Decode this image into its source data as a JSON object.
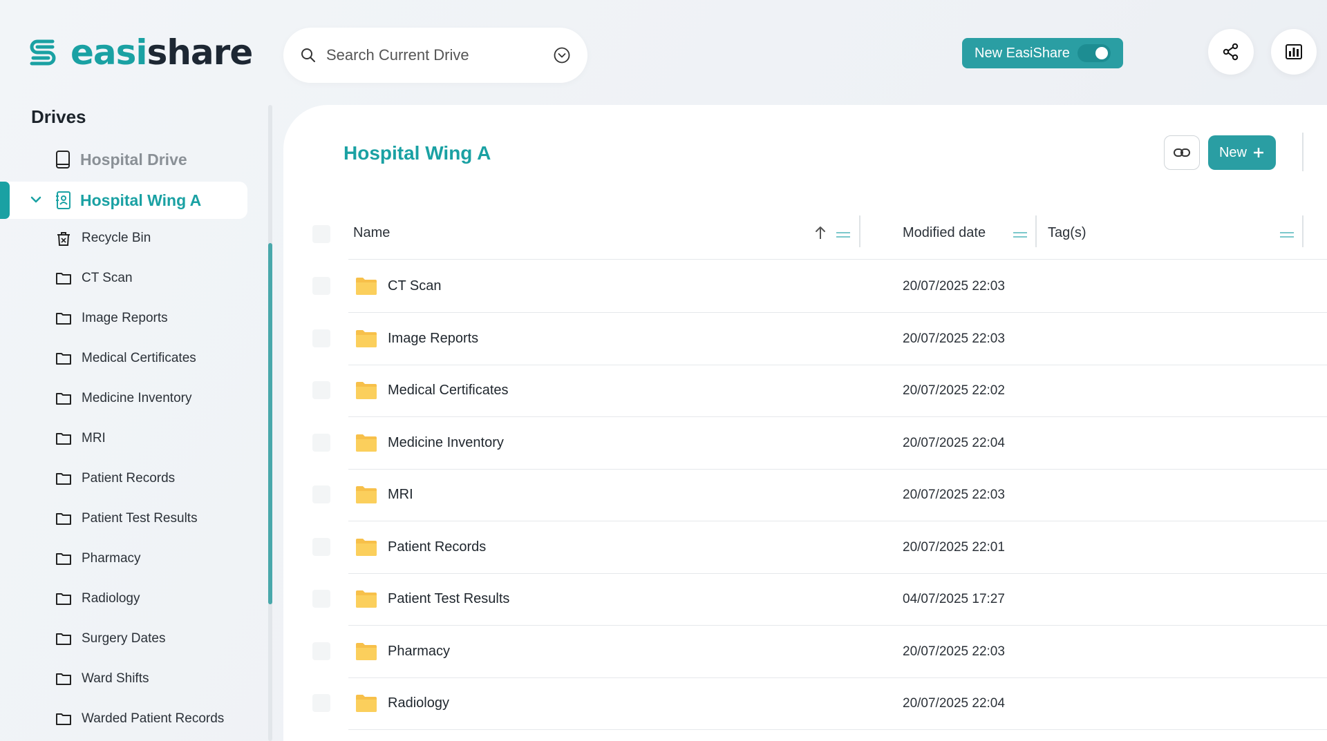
{
  "brand": {
    "prefix": "easi",
    "suffix": "share"
  },
  "search": {
    "placeholder": "Search Current Drive"
  },
  "header": {
    "toggle_label": "New EasiShare",
    "toggle_on": true,
    "share_icon": "share-nodes-icon",
    "stats_icon": "bar-chart-icon"
  },
  "sidebar": {
    "title": "Drives",
    "drives": [
      {
        "label": "Hospital Drive",
        "icon": "tablet-icon"
      },
      {
        "label": "Hospital Wing A",
        "icon": "contact-book-icon",
        "active": true,
        "expanded": true
      }
    ],
    "items": [
      {
        "label": "Recycle Bin",
        "icon": "trash-icon"
      },
      {
        "label": "CT Scan",
        "icon": "folder-icon"
      },
      {
        "label": "Image Reports",
        "icon": "folder-icon"
      },
      {
        "label": "Medical Certificates",
        "icon": "folder-icon"
      },
      {
        "label": "Medicine Inventory",
        "icon": "folder-icon"
      },
      {
        "label": "MRI",
        "icon": "folder-icon"
      },
      {
        "label": "Patient Records",
        "icon": "folder-icon"
      },
      {
        "label": "Patient Test Results",
        "icon": "folder-icon"
      },
      {
        "label": "Pharmacy",
        "icon": "folder-icon"
      },
      {
        "label": "Radiology",
        "icon": "folder-icon"
      },
      {
        "label": "Surgery Dates",
        "icon": "folder-icon"
      },
      {
        "label": "Ward Shifts",
        "icon": "folder-icon"
      },
      {
        "label": "Warded Patient Records",
        "icon": "folder-icon"
      }
    ]
  },
  "main": {
    "title": "Hospital Wing A",
    "new_label": "New",
    "columns": {
      "name": "Name",
      "modified": "Modified date",
      "tags": "Tag(s)"
    },
    "sort": {
      "column": "Name",
      "direction": "ascending"
    },
    "rows": [
      {
        "name": "CT Scan",
        "modified": "20/07/2025 22:03",
        "tags": ""
      },
      {
        "name": "Image Reports",
        "modified": "20/07/2025 22:03",
        "tags": ""
      },
      {
        "name": "Medical Certificates",
        "modified": "20/07/2025 22:02",
        "tags": ""
      },
      {
        "name": "Medicine Inventory",
        "modified": "20/07/2025 22:04",
        "tags": ""
      },
      {
        "name": "MRI",
        "modified": "20/07/2025 22:03",
        "tags": ""
      },
      {
        "name": "Patient Records",
        "modified": "20/07/2025 22:01",
        "tags": ""
      },
      {
        "name": "Patient Test Results",
        "modified": "04/07/2025 17:27",
        "tags": ""
      },
      {
        "name": "Pharmacy",
        "modified": "20/07/2025 22:03",
        "tags": ""
      },
      {
        "name": "Radiology",
        "modified": "20/07/2025 22:04",
        "tags": ""
      }
    ]
  },
  "colors": {
    "accent": "#1aa1a3",
    "button": "#2a9ea3",
    "folder": "#f7c04a"
  }
}
